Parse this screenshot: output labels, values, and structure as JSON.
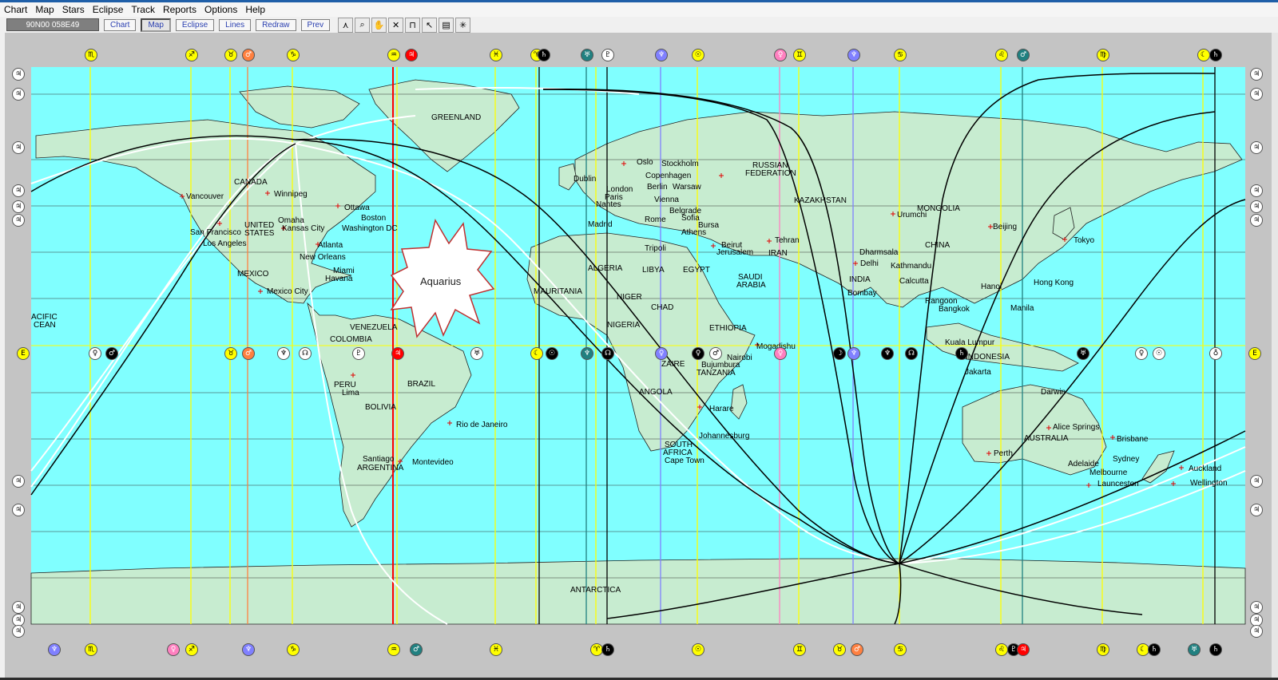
{
  "menu": [
    "Chart",
    "Map",
    "Stars",
    "Eclipse",
    "Track",
    "Reports",
    "Options",
    "Help"
  ],
  "toolbar": {
    "coordinates": "90N00  058E49",
    "buttons": [
      "Chart",
      "Map",
      "Eclipse",
      "Lines",
      "Redraw",
      "Prev"
    ],
    "active_button": "Map",
    "tools": [
      "draw-tool-icon",
      "zoom-icon",
      "hand-icon",
      "cross-icon",
      "crop-icon",
      "cursor-icon",
      "save-icon",
      "grid-icon"
    ]
  },
  "map": {
    "callout": "Aquarius",
    "labels": {
      "greenland": "GREENLAND",
      "canada": "CANADA",
      "vancouver": "Vancouver",
      "winnipeg": "Winnipeg",
      "ottawa": "Ottawa",
      "boston": "Boston",
      "omaha": "Omaha",
      "kansas": "Kansas City",
      "washington": "Washington DC",
      "united": "UNITED",
      "states": "STATES",
      "sanfrancisco": "San Francisco",
      "losangeles": "Los Angeles",
      "atlanta": "Atlanta",
      "neworleans": "New Orleans",
      "miami": "Miami",
      "havana": "Havana",
      "mexico": "MEXICO",
      "mexicocity": "Mexico City",
      "pacific1": "ACIFIC",
      "pacific2": "CEAN",
      "venezuela": "VENEZUELA",
      "colombia": "COLOMBIA",
      "peru": "PERU",
      "lima": "Lima",
      "bolivia": "BOLIVIA",
      "brazil": "BRAZIL",
      "rio": "Rio de Janeiro",
      "santiago": "Santiago",
      "argentina": "ARGENTINA",
      "montevideo": "Montevideo",
      "antarctica": "ANTARCTICA",
      "oslo": "Oslo",
      "stockholm": "Stockholm",
      "copenhagen": "Copenhagen",
      "dublin": "Dublin",
      "london": "London",
      "berlin": "Berlin",
      "warsaw": "Warsaw",
      "paris": "Paris",
      "nantes": "Nantes",
      "vienna": "Vienna",
      "belgrade": "Belgrade",
      "sofia": "Sofia",
      "rome": "Rome",
      "madrid": "Madrid",
      "bursa": "Bursa",
      "athens": "Athens",
      "tripoli": "Tripoli",
      "beirut": "Beirut",
      "jerusalem": "Jerusalem",
      "tehran": "Tehran",
      "russian": "RUSSIAN",
      "federation": "FEDERATION",
      "kazakhstan": "KAZAKHSTAN",
      "mongolia": "MONGOLIA",
      "urumchi": "Urumchi",
      "beijing": "Beijing",
      "tokyo": "Tokyo",
      "china": "CHINA",
      "algeria": "ALGERIA",
      "libya": "LIBYA",
      "egypt": "EGYPT",
      "iran": "IRAN",
      "saudi": "SAUDI",
      "arabia": "ARABIA",
      "dharmsala": "Dharmsala",
      "delhi": "Delhi",
      "kathmandu": "Kathmandu",
      "india": "INDIA",
      "calcutta": "Calcutta",
      "bombay": "Bombay",
      "hanoi": "Hanoi",
      "hongkong": "Hong Kong",
      "rangoon": "Rangoon",
      "bangkok": "Bangkok",
      "manila": "Manila",
      "mauritania": "MAURITANIA",
      "niger": "NIGER",
      "chad": "CHAD",
      "nigeria": "NIGERIA",
      "ethiopia": "ETHIOPIA",
      "mogadishu": "Mogadishu",
      "zaire": "ZAIRE",
      "nairobi": "Nairobi",
      "bujumbura": "Bujumbura",
      "tanzania": "TANZANIA",
      "angola": "ANGOLA",
      "harare": "Harare",
      "johannesburg": "Johannesburg",
      "southafrica1": "SOUTH",
      "southafrica2": "AFRICA",
      "capetown": "Cape Town",
      "kualalumpur": "Kuala Lumpur",
      "indonesia": "INDONESIA",
      "jakarta": "Jakarta",
      "darwin": "Darwin",
      "alicesprings": "Alice Springs",
      "brisbane": "Brisbane",
      "australia": "AUSTRALIA",
      "perth": "Perth",
      "adelaide": "Adelaide",
      "sydney": "Sydney",
      "melbourne": "Melbourne",
      "launceston": "Launceston",
      "auckland": "Auckland",
      "wellington": "Wellington"
    }
  },
  "colors": {
    "ocean": "#80ffff",
    "land": "#c7ecd0",
    "yellow_line": "#ffff00",
    "orange_line": "#ff8040",
    "red_line": "#ff0000",
    "blue_line": "#8080ff",
    "pink_line": "#ff80c0",
    "teal_line": "#208080"
  }
}
